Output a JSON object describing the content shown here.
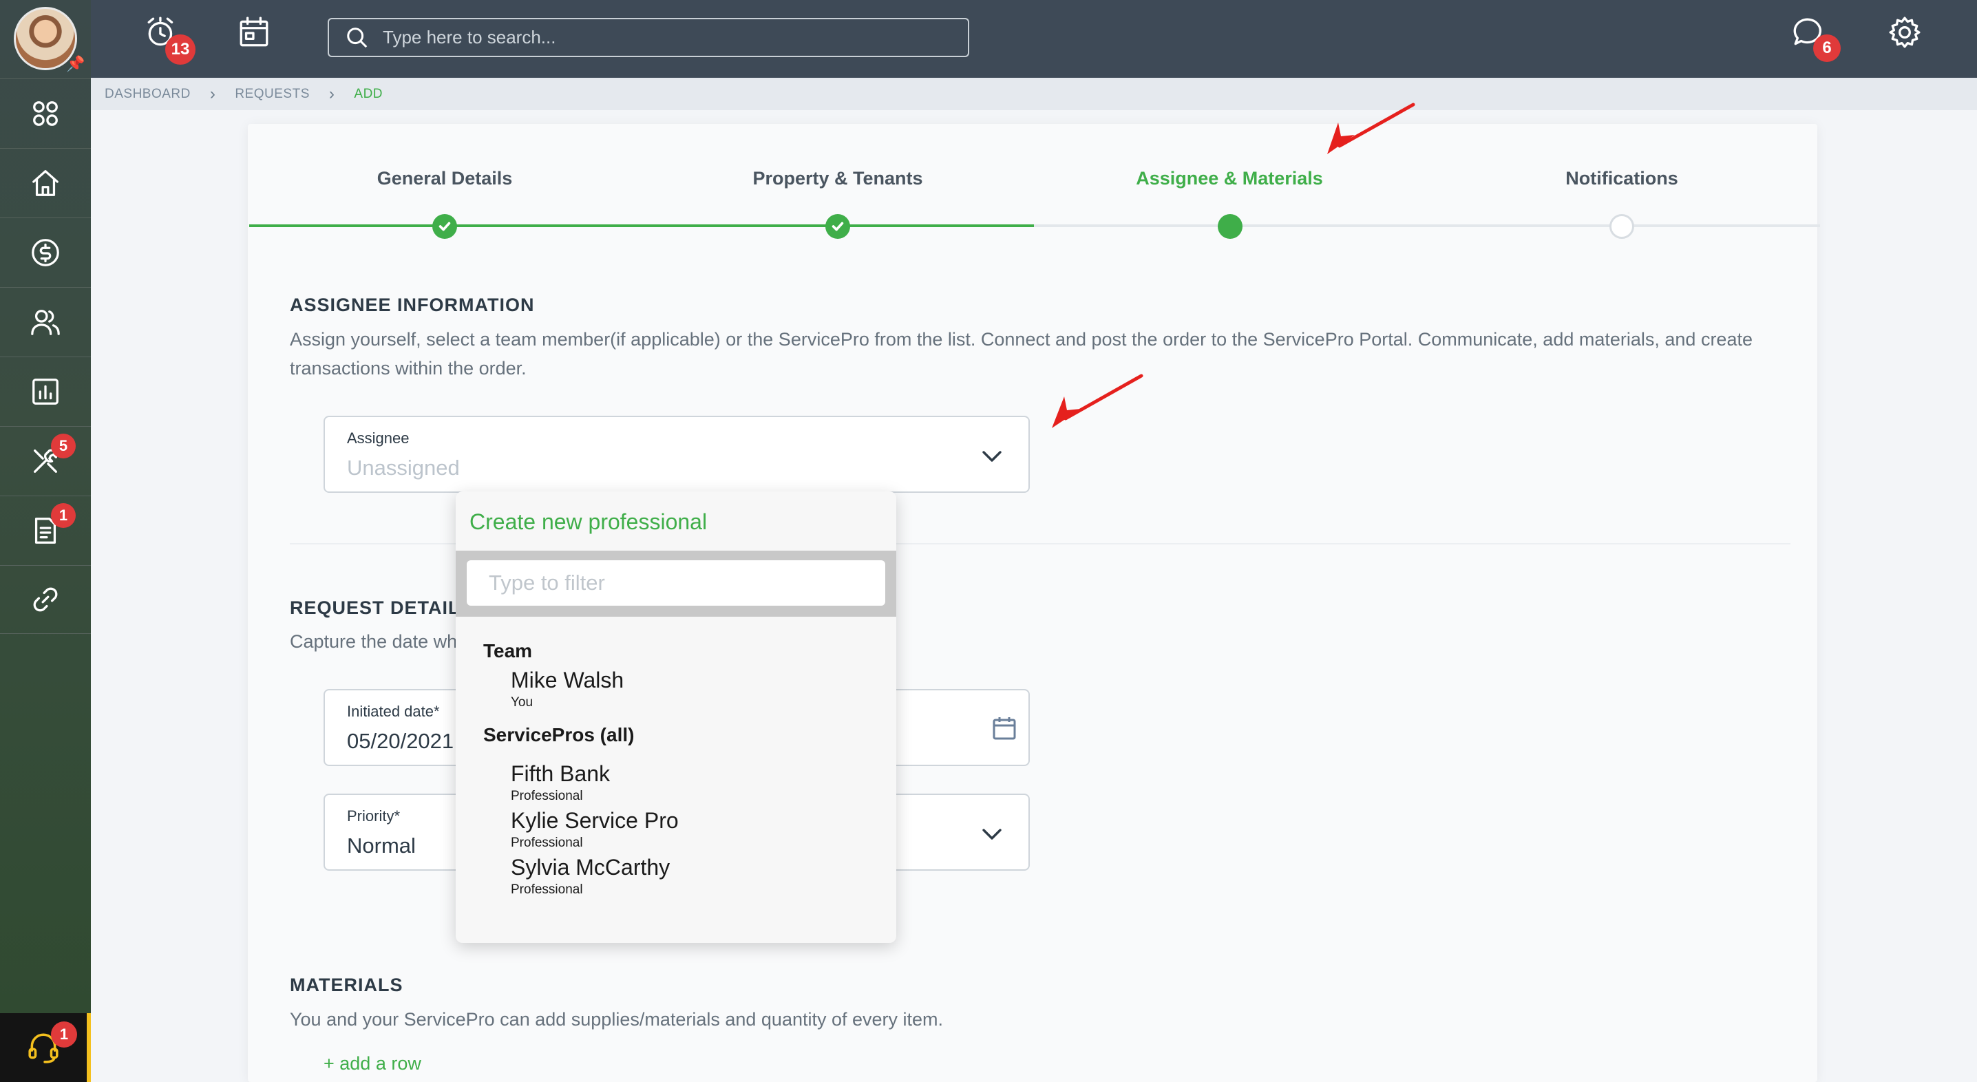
{
  "topbar": {
    "search_placeholder": "Type here to search...",
    "alerts_count": "13",
    "messages_count": "6"
  },
  "sidebar": {
    "items": [
      {
        "icon": "grid-icon"
      },
      {
        "icon": "home-icon"
      },
      {
        "icon": "dollar-icon"
      },
      {
        "icon": "users-icon"
      },
      {
        "icon": "chart-icon"
      },
      {
        "icon": "tools-icon",
        "badge": "5"
      },
      {
        "icon": "document-icon",
        "badge": "1"
      },
      {
        "icon": "link-icon"
      }
    ],
    "support_badge": "1"
  },
  "breadcrumb": {
    "items": [
      "DASHBOARD",
      "REQUESTS",
      "ADD"
    ]
  },
  "stepper": {
    "steps": [
      {
        "label": "General Details",
        "state": "done"
      },
      {
        "label": "Property & Tenants",
        "state": "done"
      },
      {
        "label": "Assignee & Materials",
        "state": "current"
      },
      {
        "label": "Notifications",
        "state": "todo"
      }
    ]
  },
  "assignee_section": {
    "title": "ASSIGNEE INFORMATION",
    "description": "Assign yourself, select a team member(if applicable) or the ServicePro from the list. Connect and post the order to the ServicePro Portal. Communicate, add materials, and create transactions within the order.",
    "field_label": "Assignee",
    "field_placeholder": "Unassigned"
  },
  "request_section": {
    "title": "REQUEST DETAILS",
    "description": "Capture the date when the request was initiated and set its priority.",
    "initiated_label": "Initiated date*",
    "initiated_value": "05/20/2021",
    "priority_label": "Priority*",
    "priority_value": "Normal"
  },
  "materials_section": {
    "title": "MATERIALS",
    "description": "You and your ServicePro can add supplies/materials and quantity of every item.",
    "add_row": "+ add a row"
  },
  "dropdown": {
    "create_label": "Create new professional",
    "filter_placeholder": "Type to filter",
    "groups": [
      {
        "label": "Team",
        "options": [
          {
            "name": "Mike Walsh",
            "sub": "You"
          }
        ]
      },
      {
        "label": "ServicePros (all)",
        "options": [
          {
            "name": "Fifth Bank",
            "sub": "Professional"
          },
          {
            "name": "Kylie Service Pro",
            "sub": "Professional"
          },
          {
            "name": "Sylvia McCarthy",
            "sub": "Professional"
          }
        ]
      }
    ]
  },
  "colors": {
    "accent_green": "#3fae49",
    "topbar": "#3e4a57",
    "badge_red": "#e03a3a",
    "annotation_red": "#e5201d"
  }
}
